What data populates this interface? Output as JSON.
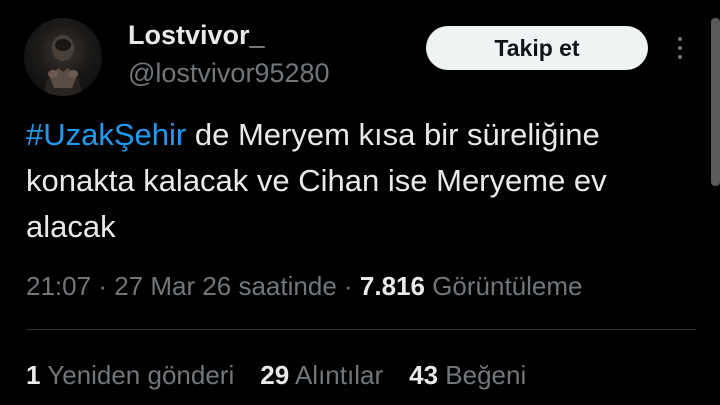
{
  "author": {
    "display_name": "Lostvivor_",
    "handle": "@lostvivor95280"
  },
  "follow_button_label": "Takip et",
  "tweet": {
    "hashtag": "#UzakŞehir",
    "text": " de Meryem kısa bir süreliğine konakta kalacak ve Cihan ise Meryeme ev alacak"
  },
  "meta": {
    "time": "21:07",
    "separator1": " · ",
    "date": "27 Mar 26 saatinde",
    "separator2": " · ",
    "views_count": "7.816",
    "views_label": "Görüntüleme"
  },
  "stats": {
    "reposts_count": "1",
    "reposts_label": "Yeniden gönderi",
    "quotes_count": "29",
    "quotes_label": "Alıntılar",
    "likes_count": "43",
    "likes_label": "Beğeni"
  },
  "icons": {
    "more": "more-options-icon"
  },
  "colors": {
    "background": "#000000",
    "primary_text": "#e7e9ea",
    "secondary_text": "#71767b",
    "link": "#1d9bf0",
    "button_bg": "#eff3f4",
    "divider": "#2f3336"
  }
}
